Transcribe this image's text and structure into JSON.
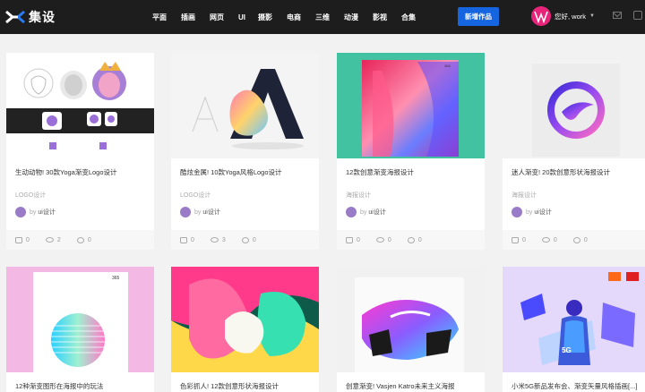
{
  "header": {
    "logo_text": "集设",
    "nav": [
      "平面",
      "插画",
      "网页",
      "UI",
      "摄影",
      "电商",
      "三维",
      "动漫",
      "影视",
      "合集"
    ],
    "upload_label": "新增作品",
    "greeting": "您好, work"
  },
  "cards_row1": [
    {
      "title": "生动动物! 30款Yoga渐变Logo设计",
      "tag": "LOGO设计",
      "by": "by",
      "author": "ui设计",
      "likes": "0",
      "views": "2",
      "comments": "0"
    },
    {
      "title": "酷炫金属! 10款Yoga风格Logo设计",
      "tag": "LOGO设计",
      "by": "by",
      "author": "ui设计",
      "likes": "0",
      "views": "3",
      "comments": "0"
    },
    {
      "title": "12款创意渐变海报设计",
      "tag": "海报设计",
      "by": "by",
      "author": "ui设计",
      "likes": "0",
      "views": "0",
      "comments": "0"
    },
    {
      "title": "迷人渐变! 20款创意形状海报设计",
      "tag": "海报设计",
      "by": "by",
      "author": "ui设计",
      "likes": "0",
      "views": "0",
      "comments": "0"
    }
  ],
  "cards_row2": [
    {
      "title": "12种渐变图形在海报中的玩法"
    },
    {
      "title": "色彩抓人! 12款创意形状海报设计"
    },
    {
      "title": "创意渐变! Vasjen Katro未来主义海报"
    },
    {
      "title": "小米5G新品发布会、渐变矢量风格插画[...]"
    }
  ],
  "thumb_text": {
    "poster_365": "365",
    "badge_5g": "5G"
  },
  "colors": {
    "accent": "#1565e0",
    "header_bg": "#1d1d1d",
    "avatar": "#e8247a"
  }
}
